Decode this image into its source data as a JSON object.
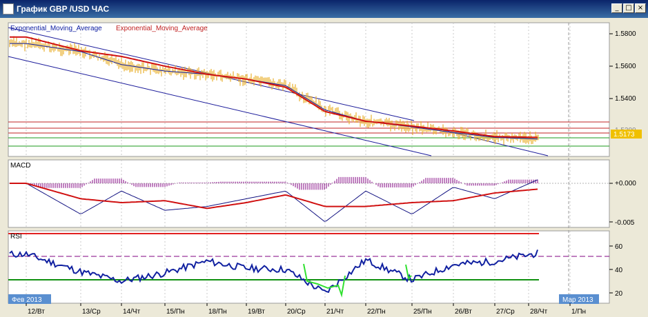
{
  "window": {
    "title": "График GBP /USD  ЧАС",
    "buttons": {
      "minimize": "_",
      "restore": "□",
      "close": "×"
    }
  },
  "colors": {
    "price": "#e8b030",
    "ema_fast": "#0a1aa0",
    "ema_slow": "#d01010",
    "channel": "#1a1a9a",
    "macd_line": "#101080",
    "macd_signal": "#d01010",
    "macd_hist": "#800080",
    "rsi": "#1020a0",
    "rsi_oversold": "#30e030",
    "level_red": "#c02020",
    "level_green": "#1a9a1a"
  },
  "main_panel": {
    "indicator_labels": [
      "Exponential_Moving_Average",
      "Exponential_Moving_Average"
    ],
    "current_price": "1.5173",
    "partial_tick": "1.5200",
    "price_ticks": [
      "1.5800",
      "1.5600",
      "1.5400"
    ]
  },
  "macd_panel": {
    "label": "MACD",
    "ticks": [
      "+0.000",
      "-0.005"
    ]
  },
  "rsi_panel": {
    "label": "RSI",
    "ticks": [
      "60",
      "40",
      "20"
    ]
  },
  "x_axis": {
    "dates": [
      "12/Вт",
      "13/Ср",
      "14/Чт",
      "15/Пн",
      "18/Пн",
      "19/Вт",
      "20/Ср",
      "21/Чт",
      "22/Пн",
      "25/Пн",
      "26/Вт",
      "27/Ср",
      "28/Чт",
      "1/Пн"
    ],
    "month_start": "Фев 2013",
    "month_end": "Мар 2013"
  },
  "chart_data": {
    "type": "line",
    "title": "График GBP /USD  ЧАС",
    "x": [
      "12/Вт",
      "13/Ср",
      "14/Чт",
      "15/Пн",
      "18/Пн",
      "19/Вт",
      "20/Ср",
      "21/Чт",
      "22/Пн",
      "25/Пн",
      "26/Вт",
      "27/Ср",
      "28/Чт"
    ],
    "ylim": [
      1.506,
      1.585
    ],
    "series": [
      {
        "name": "Exponential_Moving_Average",
        "values": [
          1.574,
          1.569,
          1.561,
          1.557,
          1.555,
          1.552,
          1.548,
          1.533,
          1.526,
          1.5225,
          1.519,
          1.516,
          1.515
        ]
      },
      {
        "name": "Exponential_Moving_Average",
        "values": [
          1.578,
          1.5695,
          1.566,
          1.56,
          1.555,
          1.552,
          1.547,
          1.532,
          1.526,
          1.523,
          1.52,
          1.5165,
          1.516
        ]
      }
    ],
    "price_last": 1.5173,
    "macd": {
      "ylim": [
        -0.006,
        0.0015
      ],
      "values": [
        0.0,
        -0.004,
        -0.001,
        -0.0035,
        -0.003,
        -0.002,
        -0.001,
        -0.005,
        -0.001,
        -0.004,
        -0.0005,
        -0.002,
        0.0005
      ]
    },
    "rsi": {
      "ylim": [
        15,
        70
      ],
      "levels": [
        30,
        50,
        70
      ],
      "values": [
        53,
        38,
        30,
        37,
        47,
        41,
        40,
        20,
        48,
        31,
        44,
        47,
        54
      ]
    }
  }
}
